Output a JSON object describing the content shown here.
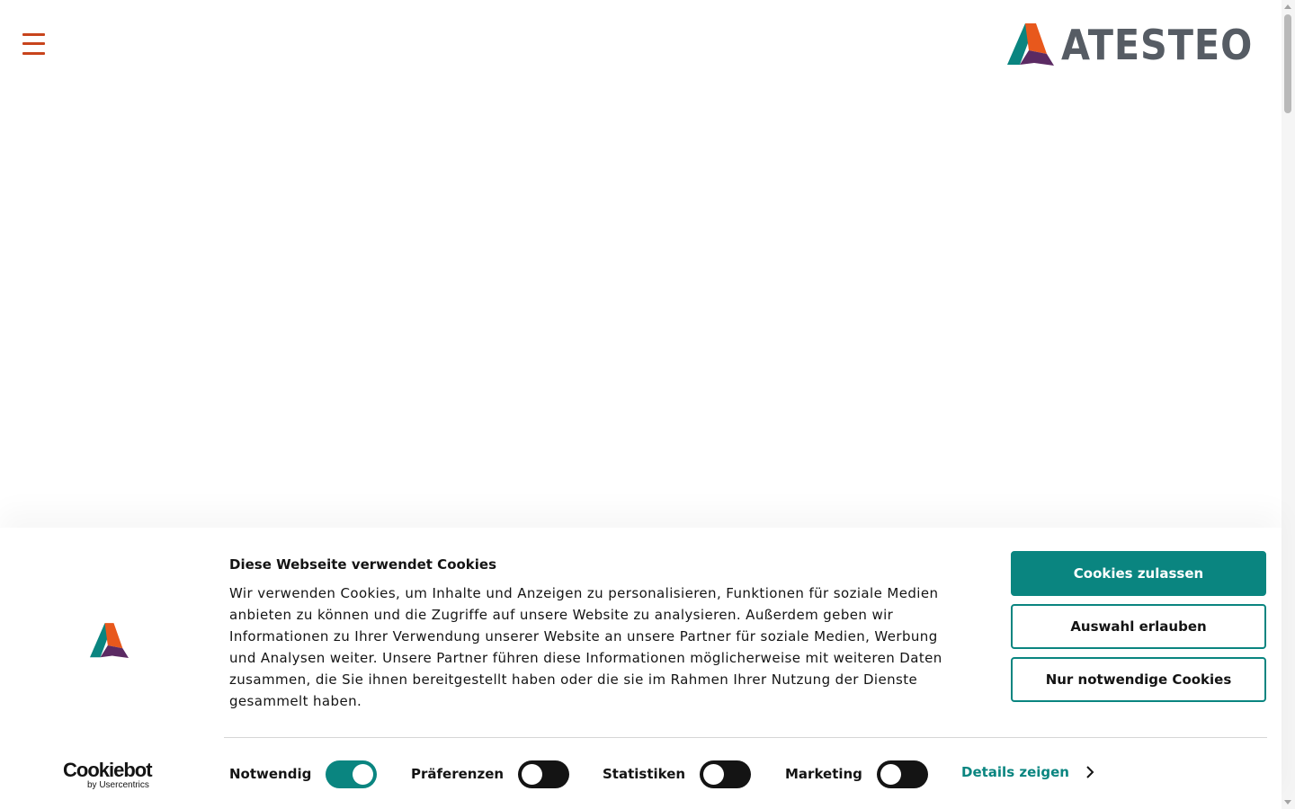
{
  "header": {
    "menu_icon": "hamburger-menu-icon",
    "logo_text": "ATESTEO",
    "brand_colors": {
      "teal": "#0a8580",
      "orange": "#e8581c",
      "purple": "#5b2a63",
      "gray": "#565c64",
      "menu": "#c8441c"
    }
  },
  "cookie_banner": {
    "title": "Diese Webseite verwendet Cookies",
    "text": "Wir verwenden Cookies, um Inhalte und Anzeigen zu personalisieren, Funktionen für soziale Medien anbieten zu können und die Zugriffe auf unsere Website zu analysieren. Außerdem geben wir Informationen zu Ihrer Verwendung unserer Website an unsere Partner für soziale Medien, Werbung und Analysen weiter. Unsere Partner führen diese Informationen möglicherweise mit weiteren Daten zusammen, die Sie ihnen bereitgestellt haben oder die sie im Rahmen Ihrer Nutzung der Dienste gesammelt haben.",
    "buttons": {
      "allow_all": "Cookies zulassen",
      "allow_selection": "Auswahl erlauben",
      "necessary_only": "Nur notwendige Cookies"
    },
    "toggles": [
      {
        "label": "Notwendig",
        "state": "on"
      },
      {
        "label": "Präferenzen",
        "state": "off"
      },
      {
        "label": "Statistiken",
        "state": "off"
      },
      {
        "label": "Marketing",
        "state": "off"
      }
    ],
    "details_link": "Details zeigen",
    "provider": {
      "name": "Cookiebot",
      "byline": "by Usercentrics"
    },
    "accent_color": "#0a8580"
  }
}
